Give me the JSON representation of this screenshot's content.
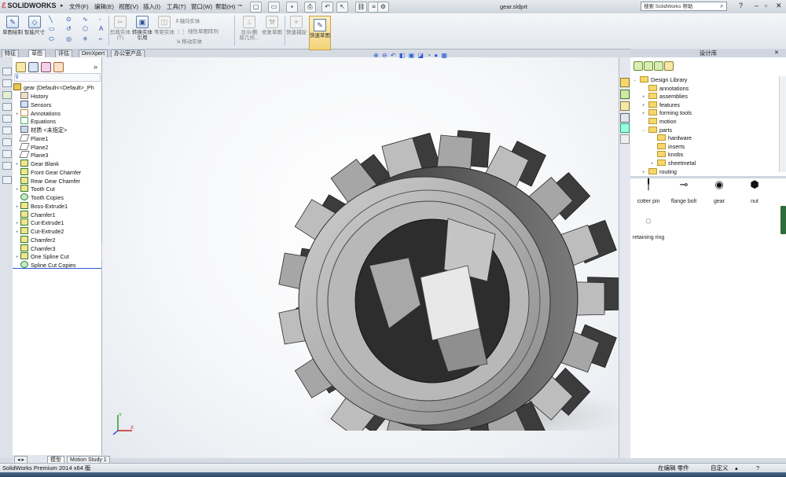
{
  "app": {
    "name": "SOLIDWORKS",
    "document_title": "gear.sldprt",
    "menu": [
      "文件(F)",
      "编辑(E)",
      "视图(V)",
      "插入(I)",
      "工具(T)",
      "窗口(W)",
      "帮助(H)"
    ],
    "search_placeholder": "搜索 SolidWorks 帮助"
  },
  "ribbon": {
    "buttons": [
      {
        "label": "草图绘制",
        "icon": "sketch-icon"
      },
      {
        "label": "智能尺寸",
        "icon": "smart-dimension-icon"
      }
    ],
    "sketch_tools": [
      "line-icon",
      "circle-icon",
      "spline-icon",
      "rectangle-icon",
      "arc-icon",
      "polygon-icon",
      "slot-icon",
      "ellipse-icon",
      "point-icon"
    ],
    "disabled_buttons": [
      {
        "label": "剪裁实体(T)",
        "icon": "trim-icon"
      },
      {
        "label": "转换实体引用",
        "icon": "convert-icon"
      },
      {
        "label": "等距实体",
        "icon": "offset-icon"
      }
    ],
    "mirror_group": [
      "镜向实体",
      "线性草图阵列",
      "移动实体"
    ],
    "display_delete_label": "显示/删除几何...",
    "repair_sketch_label": "修复草图",
    "quick_snaps_label": "快速捕捉",
    "quick_sketch_label": "快速草图"
  },
  "cmd_tabs": [
    "特征",
    "草图",
    "评估",
    "DimXpert",
    "办公室产品"
  ],
  "feature_manager": {
    "root": "gear  (Default<<Default>_Ph",
    "items": [
      {
        "label": "History",
        "icon": "hist",
        "expand": ""
      },
      {
        "label": "Sensors",
        "icon": "sensor",
        "expand": ""
      },
      {
        "label": "Annotations",
        "icon": "annot",
        "expand": "+"
      },
      {
        "label": "Equations",
        "icon": "eq",
        "expand": ""
      },
      {
        "label": "材质 <未指定>",
        "icon": "mat",
        "expand": ""
      },
      {
        "label": "Plane1",
        "icon": "plane",
        "expand": ""
      },
      {
        "label": "Plane2",
        "icon": "plane",
        "expand": ""
      },
      {
        "label": "Plane3",
        "icon": "plane",
        "expand": ""
      },
      {
        "label": "Gear Blank",
        "icon": "feat",
        "expand": "+"
      },
      {
        "label": "Front Gear Chamfer",
        "icon": "feat",
        "expand": ""
      },
      {
        "label": "Rear Gear Chamfer",
        "icon": "feat",
        "expand": ""
      },
      {
        "label": "Tooth Cut",
        "icon": "feat",
        "expand": "+"
      },
      {
        "label": "Tooth Copies",
        "icon": "pattern",
        "expand": ""
      },
      {
        "label": "Boss-Extrude1",
        "icon": "feat",
        "expand": "+"
      },
      {
        "label": "Chamfer1",
        "icon": "feat",
        "expand": ""
      },
      {
        "label": "Cut-Extrude1",
        "icon": "feat",
        "expand": "+"
      },
      {
        "label": "Cut-Extrude2",
        "icon": "feat",
        "expand": "+"
      },
      {
        "label": "Chamfer2",
        "icon": "feat",
        "expand": ""
      },
      {
        "label": "Chamfer3",
        "icon": "feat",
        "expand": ""
      },
      {
        "label": "One Spline Cut",
        "icon": "feat",
        "expand": "+"
      },
      {
        "label": "Spline Cut Copies",
        "icon": "pattern",
        "expand": ""
      }
    ]
  },
  "bottom_tabs": [
    "模型",
    "Motion Study 1"
  ],
  "task_pane": {
    "title": "设计库",
    "tree": [
      {
        "label": "Design Library",
        "level": 0,
        "expand": "−"
      },
      {
        "label": "annotations",
        "level": 1,
        "expand": ""
      },
      {
        "label": "assemblies",
        "level": 1,
        "expand": "+"
      },
      {
        "label": "features",
        "level": 1,
        "expand": "+"
      },
      {
        "label": "forming tools",
        "level": 1,
        "expand": "+"
      },
      {
        "label": "motion",
        "level": 1,
        "expand": ""
      },
      {
        "label": "parts",
        "level": 1,
        "expand": "−"
      },
      {
        "label": "hardware",
        "level": 2,
        "expand": ""
      },
      {
        "label": "inserts",
        "level": 2,
        "expand": ""
      },
      {
        "label": "knobs",
        "level": 2,
        "expand": ""
      },
      {
        "label": "sheetmetal",
        "level": 2,
        "expand": "+"
      },
      {
        "label": "routing",
        "level": 1,
        "expand": "+"
      }
    ],
    "parts": [
      {
        "label": "cotter pin",
        "icon": "cotter-pin-icon"
      },
      {
        "label": "flange bolt",
        "icon": "flange-bolt-icon"
      },
      {
        "label": "gear",
        "icon": "gear-part-icon"
      },
      {
        "label": "nut",
        "icon": "nut-icon"
      },
      {
        "label": "retaining ring",
        "icon": "retaining-ring-icon"
      }
    ]
  },
  "status": {
    "left": "SolidWorks Premium 2014 x64 版",
    "mode": "在编辑 零件",
    "units": "自定义"
  },
  "colors": {
    "selection_blue": "#2a5bd7",
    "gear_face": "#9a9a9a",
    "gear_dark": "#4a4a4a"
  }
}
